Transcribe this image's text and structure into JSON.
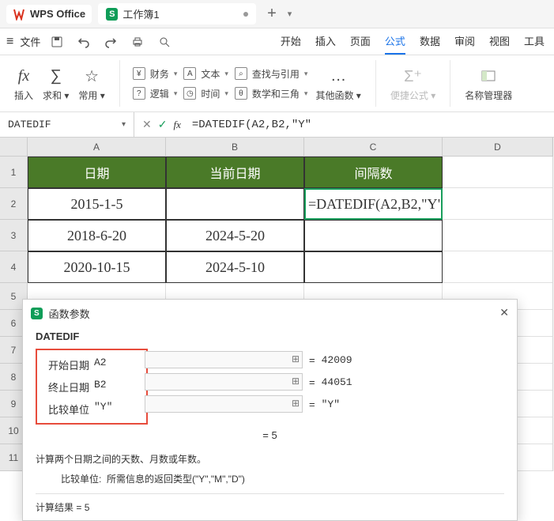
{
  "titlebar": {
    "app_name": "WPS Office",
    "doc_name": "工作簿1"
  },
  "menubar": {
    "file": "文件",
    "tabs": [
      "开始",
      "插入",
      "页面",
      "公式",
      "数据",
      "审阅",
      "视图",
      "工具"
    ],
    "active_tab_index": 3
  },
  "toolbar": {
    "insert_fn": "插入",
    "sum": "求和",
    "common": "常用",
    "finance": "财务",
    "text": "文本",
    "lookup": "查找与引用",
    "logic": "逻辑",
    "datetime": "时间",
    "math_trig": "数学和三角",
    "more_fn": "其他函数",
    "inline_formula": "便捷公式",
    "name_mgr": "名称管理器"
  },
  "formulabar": {
    "namebox": "DATEDIF",
    "formula": "=DATEDIF(A2,B2,\"Y\""
  },
  "columns": [
    "A",
    "B",
    "C",
    "D"
  ],
  "table": {
    "headers": [
      "日期",
      "当前日期",
      "间隔数"
    ],
    "rows": [
      {
        "date": "2015-1-5",
        "current": "",
        "interval_editing": "=DATEDIF(A2,B2,\"Y\""
      },
      {
        "date": "2018-6-20",
        "current": "2024-5-20",
        "interval": ""
      },
      {
        "date": "2020-10-15",
        "current": "2024-5-10",
        "interval": ""
      }
    ]
  },
  "dialog": {
    "title": "函数参数",
    "func_name": "DATEDIF",
    "params": [
      {
        "label": "开始日期",
        "arg": "A2",
        "value": "42009"
      },
      {
        "label": "终止日期",
        "arg": "B2",
        "value": "44051"
      },
      {
        "label": "比较单位",
        "arg": "\"Y\"",
        "value": "\"Y\""
      }
    ],
    "preview_result": "= 5",
    "description": "计算两个日期之间的天数、月数或年数。",
    "param_help_label": "比较单位:",
    "param_help": "所需信息的返回类型(\"Y\",\"M\",\"D\")",
    "calc_result_label": "计算结果 = ",
    "calc_result": "5"
  }
}
